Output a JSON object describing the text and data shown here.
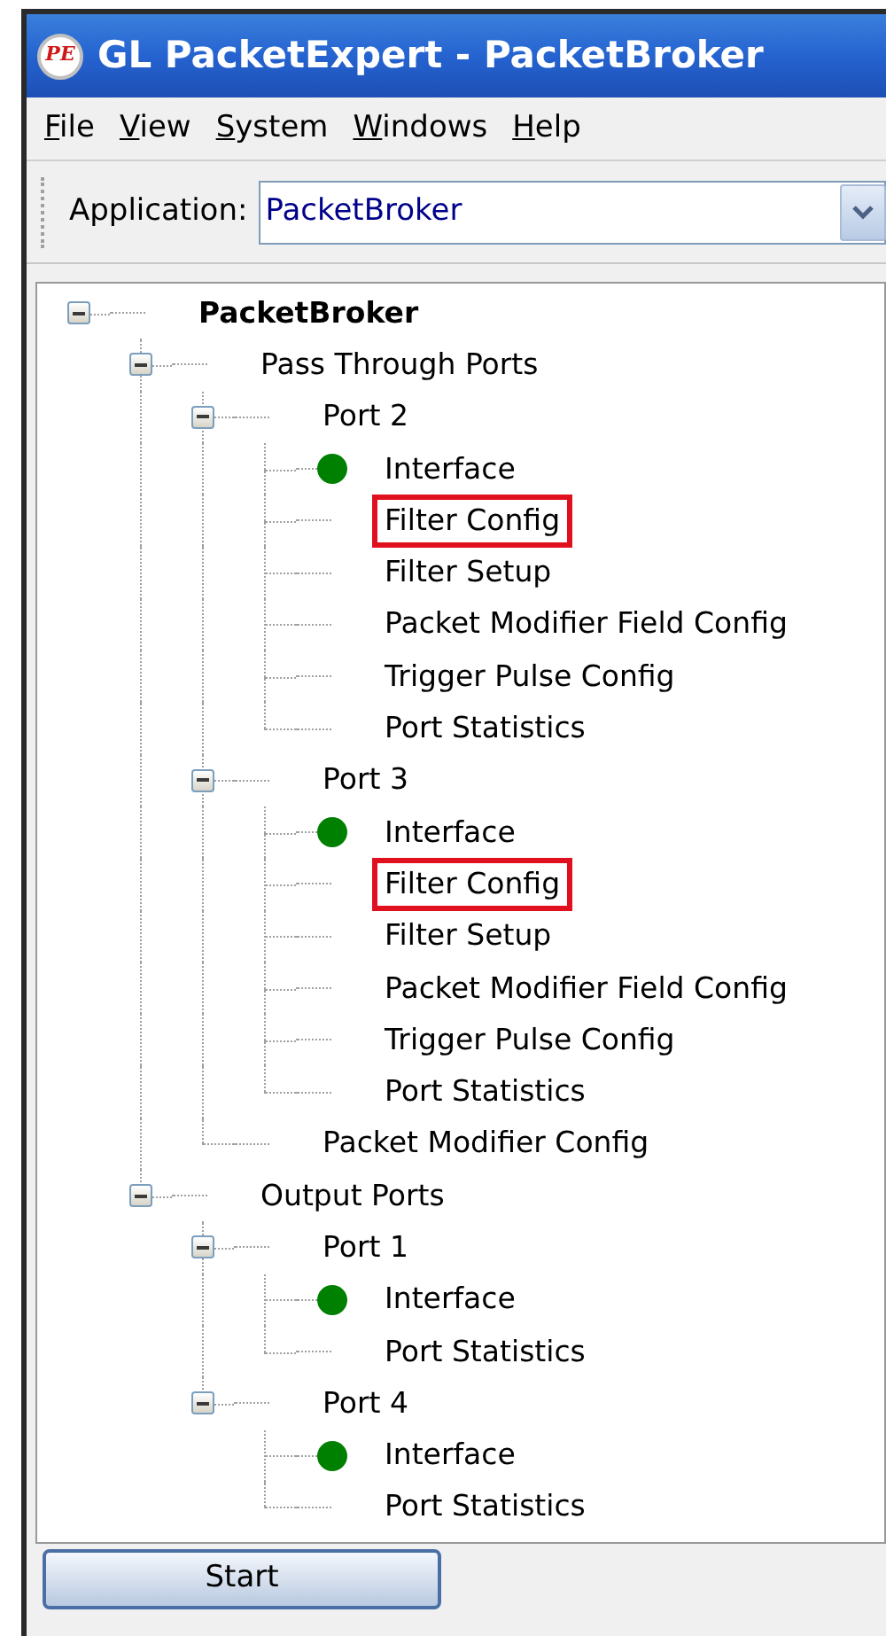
{
  "window": {
    "title": "GL PacketExpert - PacketBroker",
    "logo": "PE"
  },
  "menu": [
    "File",
    "View",
    "System",
    "Windows",
    "Help"
  ],
  "toolbar": {
    "label": "Application:",
    "value": "PacketBroker"
  },
  "tree": [
    {
      "label": "PacketBroker",
      "expanded": true,
      "children": [
        {
          "label": "Pass Through Ports",
          "expanded": true,
          "children": [
            {
              "label": "Port 2",
              "expanded": true,
              "children": [
                {
                  "label": "Interface",
                  "color": "#008000",
                  "highlighted": false
                },
                {
                  "label": "Filter Config",
                  "highlighted": true
                },
                {
                  "label": "Filter Setup",
                  "highlighted": false
                },
                {
                  "label": "Packet Modifier Field Config",
                  "highlighted": false
                },
                {
                  "label": "Trigger Pulse Config",
                  "highlighted": false
                },
                {
                  "label": "Port Statistics",
                  "highlighted": false
                }
              ]
            },
            {
              "label": "Port 3",
              "expanded": true,
              "children": [
                {
                  "label": "Interface",
                  "color": "#008000",
                  "highlighted": false
                },
                {
                  "label": "Filter Config",
                  "highlighted": true
                },
                {
                  "label": "Filter Setup",
                  "highlighted": false
                },
                {
                  "label": "Packet Modifier Field Config",
                  "highlighted": false
                },
                {
                  "label": "Trigger Pulse Config",
                  "highlighted": false
                },
                {
                  "label": "Port Statistics",
                  "highlighted": false
                }
              ]
            },
            {
              "label": "Packet Modifier Config",
              "highlighted": false
            }
          ]
        },
        {
          "label": "Output Ports",
          "expanded": true,
          "children": [
            {
              "label": "Port 1",
              "expanded": true,
              "children": [
                {
                  "label": "Interface",
                  "color": "#008000",
                  "highlighted": false
                },
                {
                  "label": "Port Statistics",
                  "highlighted": false
                }
              ]
            },
            {
              "label": "Port 4",
              "expanded": true,
              "children": [
                {
                  "label": "Interface",
                  "color": "#008000",
                  "highlighted": false
                },
                {
                  "label": "Port Statistics",
                  "highlighted": false
                }
              ]
            }
          ]
        }
      ]
    }
  ],
  "start_button": "Start"
}
